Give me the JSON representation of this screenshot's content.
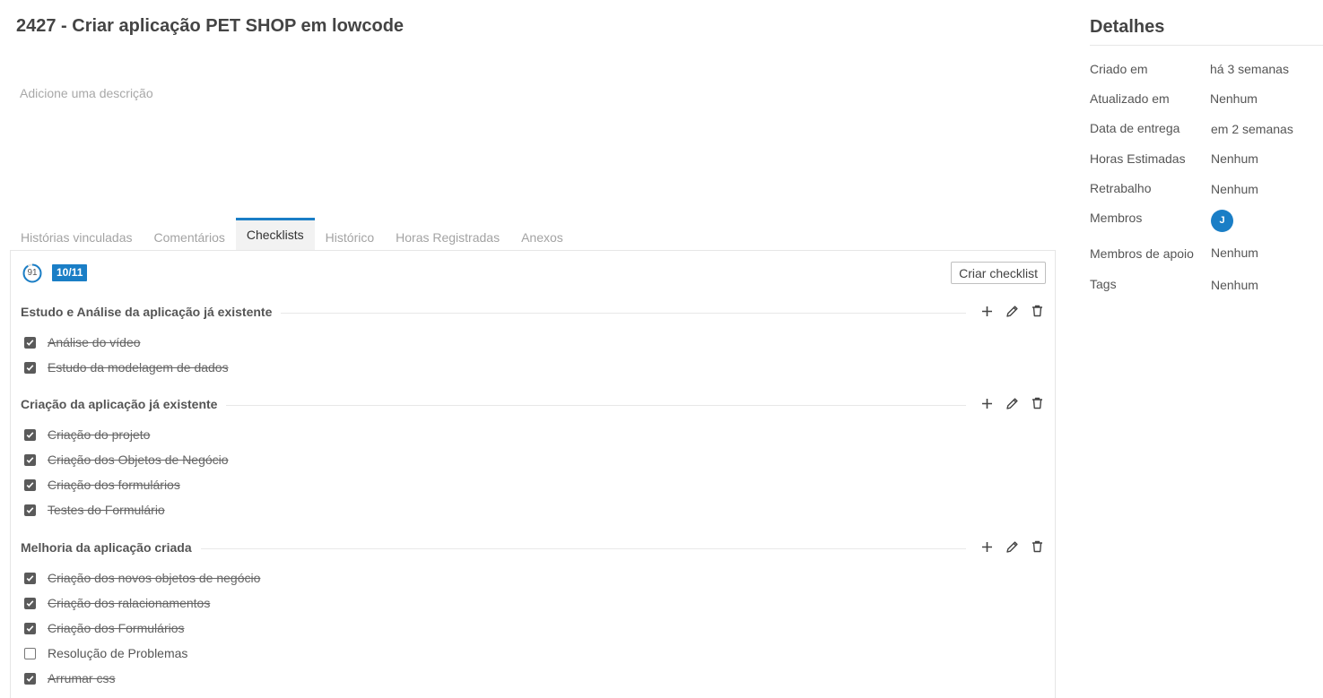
{
  "card": {
    "title": "2427 - Criar aplicação PET SHOP em lowcode",
    "description_placeholder": "Adicione uma descrição"
  },
  "tabs": [
    {
      "label": "Histórias vinculadas",
      "active": false
    },
    {
      "label": "Comentários",
      "active": false
    },
    {
      "label": "Checklists",
      "active": true
    },
    {
      "label": "Histórico",
      "active": false
    },
    {
      "label": "Horas Registradas",
      "active": false
    },
    {
      "label": "Anexos",
      "active": false
    }
  ],
  "checklists": {
    "progress_percent": "91",
    "count": "10/11",
    "create_label": "Criar checklist",
    "accent_color": "#1a7ec6",
    "groups": [
      {
        "title": "Estudo e Análise da aplicação já existente",
        "items": [
          {
            "label": "Análise do vídeo",
            "checked": true
          },
          {
            "label": "Estudo da modelagem de dados",
            "checked": true
          }
        ]
      },
      {
        "title": "Criação da aplicação já existente",
        "items": [
          {
            "label": "Criação do projeto",
            "checked": true
          },
          {
            "label": "Criação dos Objetos de Negócio",
            "checked": true
          },
          {
            "label": "Criação dos formulários",
            "checked": true
          },
          {
            "label": "Testes do Formulário",
            "checked": true
          }
        ]
      },
      {
        "title": "Melhoria da aplicação criada",
        "items": [
          {
            "label": "Criação dos novos objetos de negócio",
            "checked": true
          },
          {
            "label": "Criação dos ralacionamentos",
            "checked": true
          },
          {
            "label": "Criação dos Formulários",
            "checked": true
          },
          {
            "label": "Resolução de Problemas",
            "checked": false
          },
          {
            "label": "Arrumar css",
            "checked": true
          }
        ]
      }
    ]
  },
  "details": {
    "title": "Detalhes",
    "rows": [
      {
        "key": "Criado em",
        "value": "há 3 semanas"
      },
      {
        "key": "Atualizado em",
        "value": "Nenhum"
      },
      {
        "key": "Data de entrega",
        "value": "em 2 semanas"
      },
      {
        "key": "Horas Estimadas",
        "value": "Nenhum"
      },
      {
        "key": "Retrabalho",
        "value": "Nenhum"
      },
      {
        "key": "Membros",
        "avatar": "J"
      },
      {
        "key": "Membros de apoio",
        "value": "Nenhum"
      },
      {
        "key": "Tags",
        "value": "Nenhum"
      }
    ]
  }
}
